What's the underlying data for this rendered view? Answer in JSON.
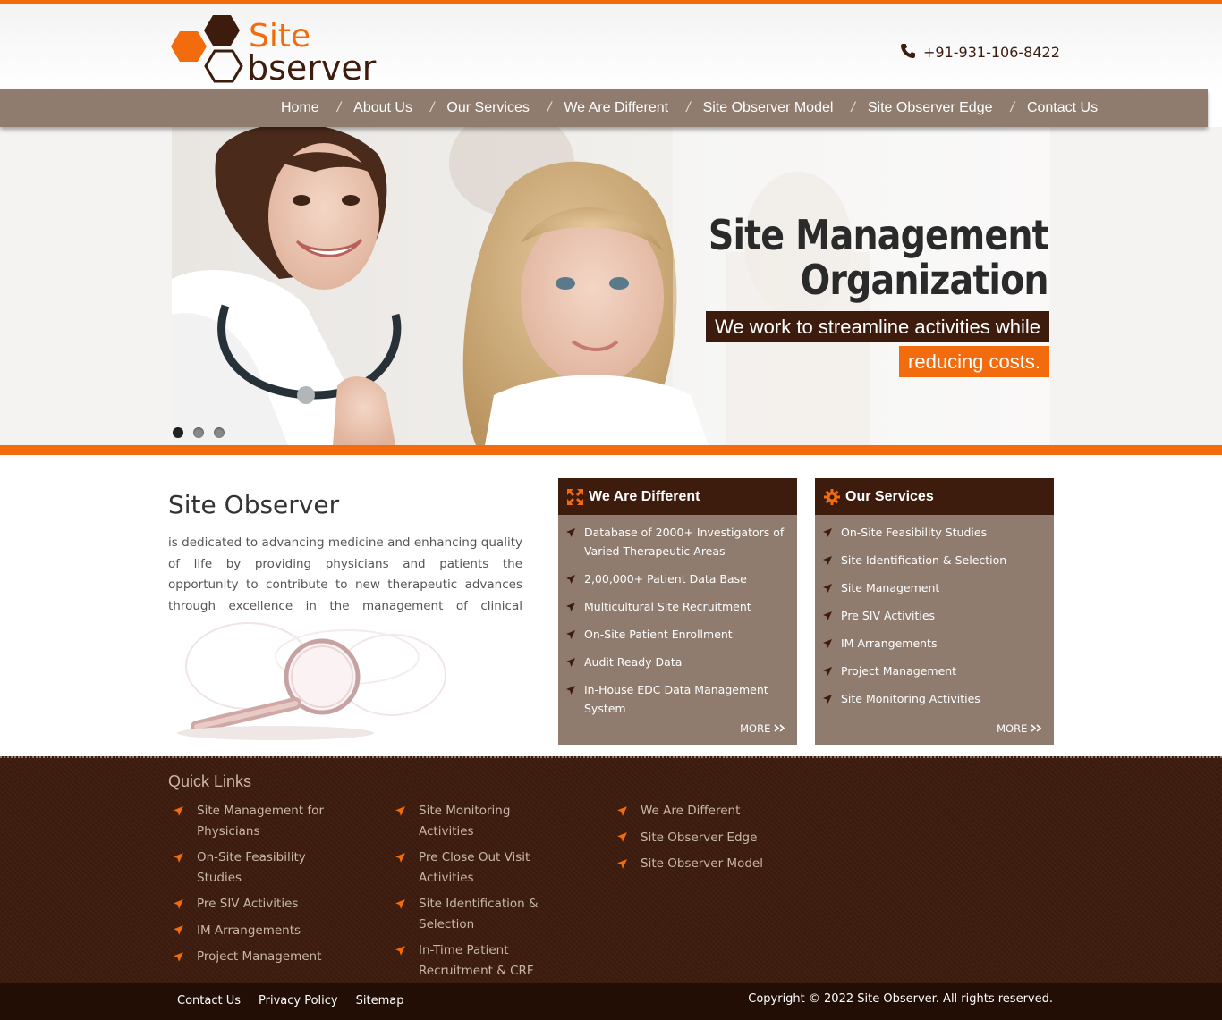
{
  "header": {
    "logo_site": "Site",
    "logo_observer": "bserver",
    "phone": "+91-931-106-8422"
  },
  "nav": {
    "items": [
      {
        "label": "Home"
      },
      {
        "label": "About Us"
      },
      {
        "label": "Our Services"
      },
      {
        "label": "We Are Different"
      },
      {
        "label": "Site Observer Model"
      },
      {
        "label": "Site Observer Edge"
      },
      {
        "label": "Contact Us"
      }
    ],
    "separator": "/"
  },
  "hero": {
    "title_line1": "Site Management",
    "title_line2": "Organization",
    "tagline_line1": "We work to streamline activities while",
    "tagline_line2": "reducing costs.",
    "slides": 3,
    "active_slide": 1
  },
  "intro": {
    "title": "Site Observer",
    "text": "is dedicated to advancing medicine and enhancing quality of life by providing physicians and patients the opportunity to contribute to new therapeutic advances through excellence in the management of clinical research services..."
  },
  "different_box": {
    "icon": "arrows-expand-icon",
    "title": "We Are Different",
    "items": [
      "Database of 2000+ Investigators of Varied Therapeutic Areas",
      "2,00,000+ Patient Data Base",
      "Multicultural Site Recruitment",
      "On-Site Patient Enrollment",
      "Audit Ready Data",
      "In-House EDC Data Management System"
    ],
    "more": "MORE"
  },
  "services_box": {
    "icon": "gear-icon",
    "title": "Our Services",
    "items": [
      "On-Site Feasibility Studies",
      "Site Identification & Selection",
      "Site Management",
      "Pre SIV Activities",
      "IM Arrangements",
      "Project Management",
      "Site Monitoring Activities"
    ],
    "more": "MORE"
  },
  "footer": {
    "quick_links_title": "Quick Links",
    "col1": [
      "Site Management for Physicians",
      "On-Site Feasibility Studies",
      "Pre SIV Activities",
      "IM Arrangements",
      "Project Management"
    ],
    "col2": [
      "Site Monitoring Activities",
      "Pre Close Out Visit Activities",
      "Site Identification & Selection",
      "In-Time Patient Recruitment & CRF Completion"
    ],
    "col3": [
      "We Are Different",
      "Site Observer Edge",
      "Site Observer Model"
    ],
    "bottom_links": [
      "Contact Us",
      "Privacy Policy",
      "Sitemap"
    ],
    "copyright": "Copyright © 2022 Site Observer. All rights reserved."
  },
  "colors": {
    "accent": "#f26c0d",
    "dark_brown": "#3d1c0e",
    "taupe": "#8f7c6f",
    "footer_bottom": "#230e06"
  }
}
